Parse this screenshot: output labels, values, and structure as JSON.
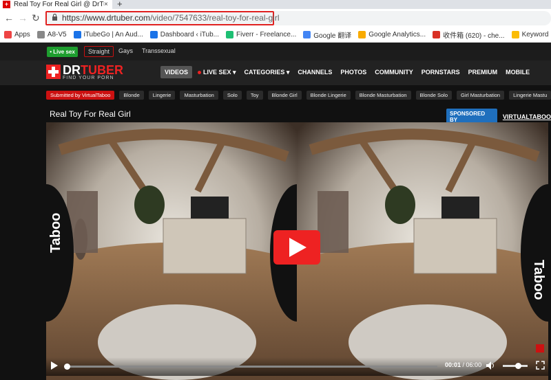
{
  "browser": {
    "tab_title": "Real Toy For Real Girl @ DrTu",
    "tab_close": "×",
    "new_tab": "+",
    "url_host": "https://www.drtuber.com",
    "url_path": "/video/7547633/real-toy-for-real-girl",
    "bookmarks": [
      {
        "label": "Apps",
        "icon_color": "#e44"
      },
      {
        "label": "A8-V5",
        "icon_color": "#888"
      },
      {
        "label": "iTubeGo | An Aud...",
        "icon_color": "#1a73e8"
      },
      {
        "label": "Dashboard ‹ iTub...",
        "icon_color": "#1a73e8"
      },
      {
        "label": "Fiverr - Freelance...",
        "icon_color": "#1dbf73"
      },
      {
        "label": "Google 翻译",
        "icon_color": "#4285f4"
      },
      {
        "label": "Google Analytics...",
        "icon_color": "#f9ab00"
      },
      {
        "label": "收件箱 (620) - che...",
        "icon_color": "#d93025"
      },
      {
        "label": "Keyword Planner...",
        "icon_color": "#fbbc04"
      }
    ]
  },
  "site": {
    "live_sex_button": "• Live sex",
    "top_categories": [
      "Straight",
      "Gays",
      "Transsexual"
    ],
    "logo_dr": "DR",
    "logo_tuber": "TUBER",
    "logo_slogan": "FIND YOUR PORN",
    "nav": [
      "VIDEOS",
      "LIVE SEX ▾",
      "CATEGORIES ▾",
      "CHANNELS",
      "PHOTOS",
      "COMMUNITY",
      "PORNSTARS",
      "PREMIUM",
      "MOBILE"
    ],
    "tags": [
      "Submitted by VirtualTaboo",
      "Blonde",
      "Lingerie",
      "Masturbation",
      "Solo",
      "Toy",
      "Blonde Girl",
      "Blonde Lingerie",
      "Blonde Masturbation",
      "Blonde Solo",
      "Girl Masturbation",
      "Lingerie Mastu"
    ],
    "video_title": "Real Toy For Real Girl",
    "sponsored_by": "SPONSORED BY",
    "sponsor_name": "VIRTUALTABOO",
    "watermark": "Virtual Taboo",
    "player": {
      "current_time": "00:01",
      "duration": "06:00",
      "progress": 0.003,
      "volume": 0.6
    },
    "colors": {
      "accent": "#e22222",
      "live": "#1e9e2f",
      "sponsor": "#1f6fbd"
    }
  }
}
